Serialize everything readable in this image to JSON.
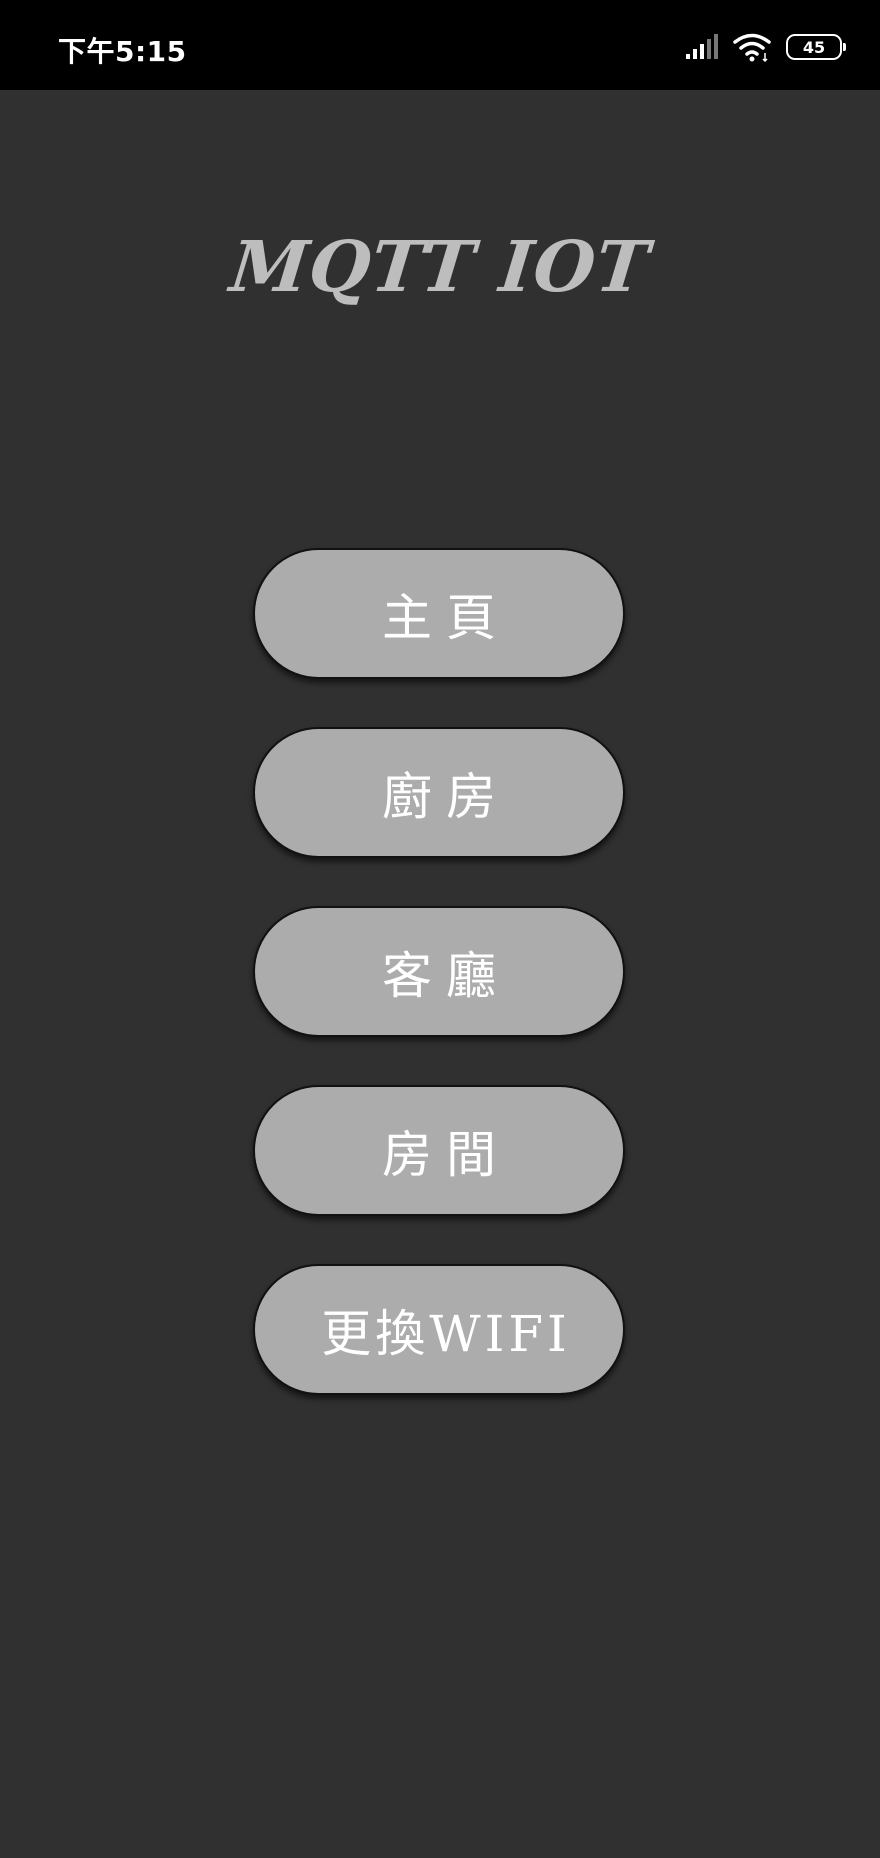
{
  "status_bar": {
    "time": "下午5:15",
    "battery": "45",
    "icons": [
      "signal-icon",
      "wifi-icon",
      "battery-icon"
    ]
  },
  "app": {
    "title": "MQTT IOT"
  },
  "menu": {
    "items": [
      {
        "label": "主頁"
      },
      {
        "label": "廚房"
      },
      {
        "label": "客廳"
      },
      {
        "label": "房間"
      },
      {
        "label": "更換WIFI"
      }
    ]
  },
  "colors": {
    "background": "#303030",
    "button": "#acacac",
    "title": "#bdbdbd"
  }
}
